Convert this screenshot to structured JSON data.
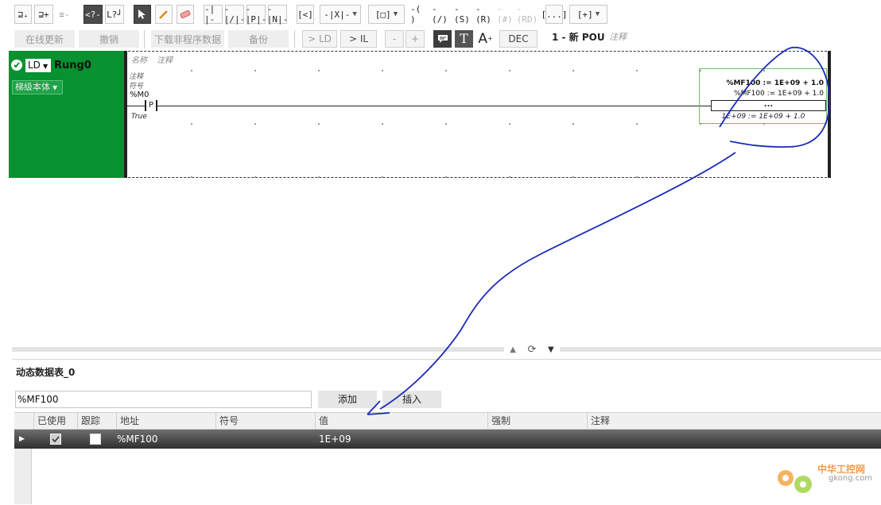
{
  "toolbar": {
    "row1": {
      "ld_branch_label": "LD▾",
      "undo_icon": "<?-",
      "branch_icon": "L?┘",
      "contact_open": "-| |-",
      "contact_closed": "-|/|-",
      "contact_p": "-|P|-",
      "contact_n": "-|N|-",
      "compare_label": "[<]",
      "coil_label": "-( )",
      "coil_neg_label": "-(/)",
      "coil_set_label": "-(S)",
      "coil_reset_label": "-(R)",
      "coil_hash": "-(#)",
      "coil_rd": "-(RD)",
      "block_label": "[...]",
      "add_label": "+"
    },
    "row2": {
      "online_update": "在线更新",
      "undo": "撤销",
      "download": "下载非程序数据",
      "backup": "备份",
      "to_ld": "> LD",
      "to_il": "> IL",
      "minus": "-",
      "plus": "+",
      "dec": "DEC",
      "pou_title": "1 - 新 POU",
      "comment": "注释"
    }
  },
  "rung": {
    "language": "LD",
    "name": "Rung0",
    "body_dropdown": "梯级本体",
    "name_label": "名称",
    "comment_label": "注释",
    "contact_comment": "注释",
    "contact_symbol": "符号",
    "contact_address": "%M0",
    "contact_type": "P",
    "contact_value": "True",
    "block_line1": "%MF100 := 1E+09 + 1.0",
    "block_line2": "%MF100 := 1E+09 + 1.0",
    "block_dots": "...",
    "block_result": "1E+09 := 1E+09 + 1.0"
  },
  "table": {
    "title": "动态数据表_0",
    "input_value": "%MF100",
    "add_button": "添加",
    "insert_button": "插入",
    "columns": [
      "已使用",
      "跟踪",
      "地址",
      "符号",
      "值",
      "强制",
      "注释"
    ],
    "rows": [
      {
        "used": true,
        "track": false,
        "address": "%MF100",
        "symbol": "",
        "value": "1E+09",
        "force": "",
        "comment": ""
      }
    ]
  },
  "watermark": {
    "cn": "中华工控网",
    "url": "gkong.com"
  },
  "colors": {
    "rung_green": "#079130",
    "annotation_blue": "#1a2bb8"
  }
}
